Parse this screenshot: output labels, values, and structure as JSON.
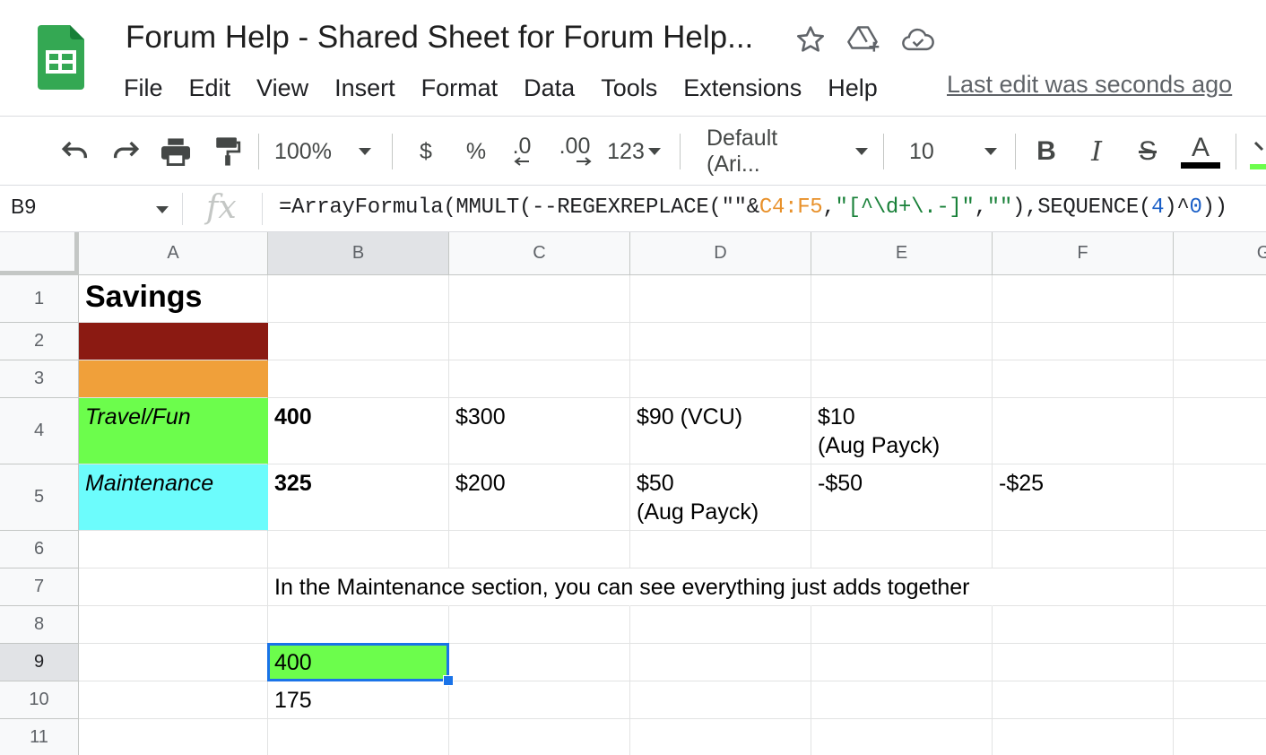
{
  "header": {
    "title": "Forum Help - Shared Sheet for Forum Help...",
    "menu": [
      "File",
      "Edit",
      "View",
      "Insert",
      "Format",
      "Data",
      "Tools",
      "Extensions",
      "Help"
    ],
    "last_edit": "Last edit was seconds ago",
    "icons": [
      "sheets-logo-icon",
      "star-icon",
      "move-to-drive-icon",
      "cloud-saved-icon"
    ]
  },
  "toolbar": {
    "zoom": "100%",
    "currency": "$",
    "percent": "%",
    "decrease_decimal": ".0",
    "increase_decimal": ".00",
    "more_formats": "123",
    "font": "Default (Ari...",
    "font_size": "10",
    "bold": "B",
    "italic": "I",
    "strike": "S",
    "text_color": "A"
  },
  "formula_bar": {
    "cell_ref": "B9",
    "fx": "fx",
    "p1": "=ArrayFormula(MMULT(--REGEXREPLACE(\"\"&",
    "p2": "C4:F5",
    "p3": ",",
    "p4": "\"[^\\d+\\.-]\"",
    "p5": ",",
    "p6": "\"\"",
    "p7": "),SEQUENCE(",
    "p8": "4",
    "p9": ")^",
    "p10": "0",
    "p11": "))"
  },
  "grid": {
    "columns": [
      "A",
      "B",
      "C",
      "D",
      "E",
      "F",
      "G"
    ],
    "rows": [
      "1",
      "2",
      "3",
      "4",
      "5",
      "6",
      "7",
      "8",
      "9",
      "10",
      "11"
    ],
    "cells": {
      "A1": "Savings",
      "A4": "Travel/Fun",
      "B4": "400",
      "C4": "$300",
      "D4": "$90 (VCU)",
      "E4": "$10\n(Aug Payck)",
      "A5": "Maintenance",
      "B5": "325",
      "C5": "$200",
      "D5": "$50\n(Aug Payck)",
      "E5": "-$50",
      "F5": "-$25",
      "B7": "In the Maintenance section, you can see everything just adds together",
      "B9": "400",
      "B10": "175"
    },
    "selected_cell": "B9",
    "colors": {
      "A2": "#8b1a12",
      "A3": "#f0a03a",
      "A4": "#6cfd4c",
      "A5": "#6cfcfc",
      "B9": "#6cfd4c",
      "selection": "#1a73e8"
    }
  }
}
